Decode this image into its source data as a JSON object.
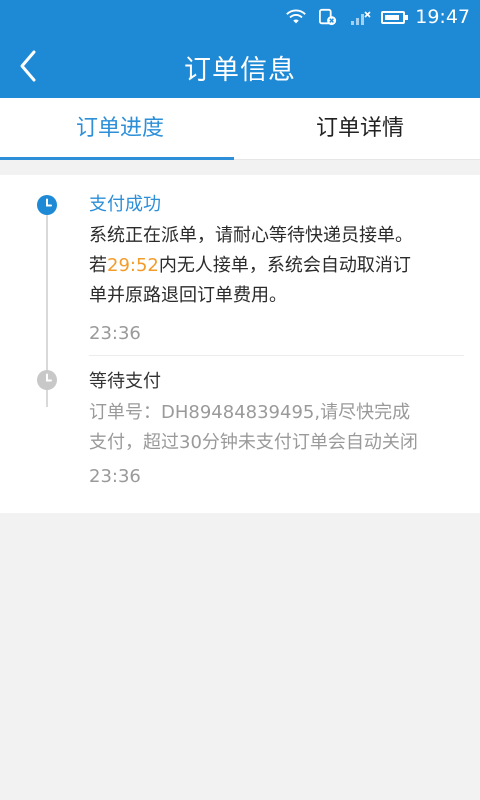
{
  "status_bar": {
    "time": "19:47",
    "icons": [
      "wifi-icon",
      "sim-disabled-icon",
      "signal-icon",
      "battery-icon"
    ]
  },
  "header": {
    "title": "订单信息",
    "back_icon": "chevron-left-icon"
  },
  "tabs": [
    {
      "label": "订单进度",
      "active": true
    },
    {
      "label": "订单详情",
      "active": false
    }
  ],
  "timeline": [
    {
      "title": "支付成功",
      "line1": "系统正在派单，请耐心等待快递员接单。",
      "line2_prefix": "若",
      "countdown": "29:52",
      "line2_suffix": "内无人接单，系统会自动取消订",
      "line3": "单并原路退回订单费用。",
      "time": "23:36",
      "status": "active"
    },
    {
      "title": "等待支付",
      "line1": "订单号：DH89484839495,请尽快完成",
      "line2": "支付，超过30分钟未支付订单会自动关闭",
      "time": "23:36",
      "status": "inactive"
    }
  ],
  "colors": {
    "primary": "#1e8ad6",
    "active_tab": "#2c8fd8",
    "countdown": "#f39c2b",
    "inactive_node": "#c8c8c8"
  }
}
